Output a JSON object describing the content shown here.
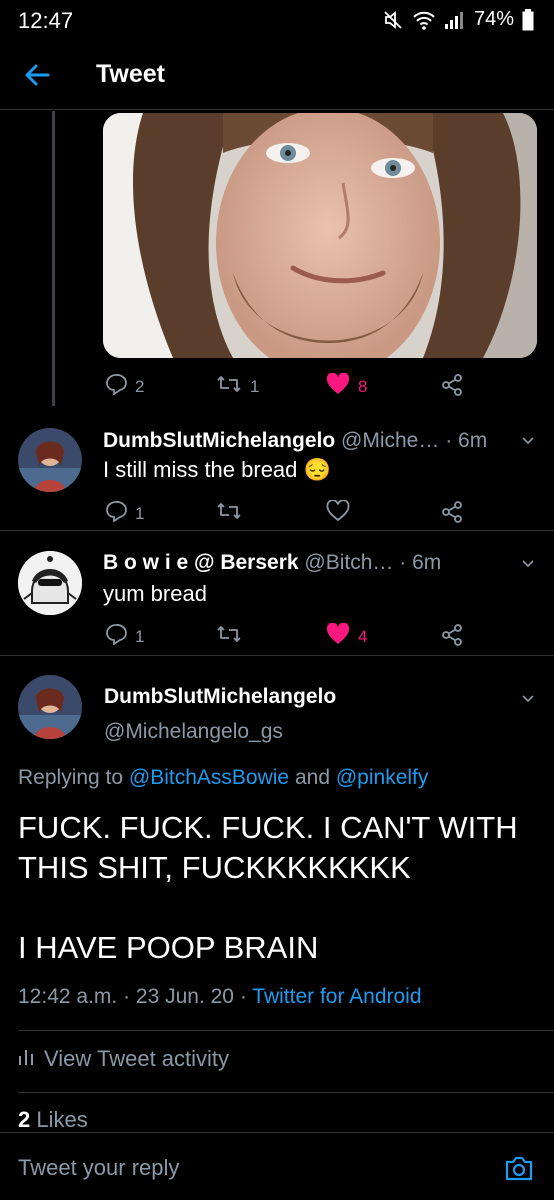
{
  "status_bar": {
    "time": "12:47",
    "battery": "74%"
  },
  "header": {
    "title": "Tweet"
  },
  "parent_tweet_actions": {
    "replies": "2",
    "retweets": "1",
    "likes": "8"
  },
  "replies": [
    {
      "name": "DumbSlutMichelangelo",
      "handle": "@Miche…",
      "time": "· 6m",
      "text": "I still miss the bread",
      "emoji": "😔",
      "replies": "1",
      "retweets": "",
      "likes": ""
    },
    {
      "name": "B o w i e @ Berserk",
      "handle": "@Bitch…",
      "time": "· 6m",
      "text": "yum bread",
      "replies": "1",
      "retweets": "",
      "likes": "4"
    }
  ],
  "main_tweet": {
    "name": "DumbSlutMichelangelo",
    "handle": "@Michelangelo_gs",
    "replying_prefix": "Replying to",
    "replying_to_1": "@BitchAssBowie",
    "replying_and": "and",
    "replying_to_2": "@pinkelfy",
    "body": "FUCK. FUCK. FUCK. I CAN'T WITH THIS SHIT, FUCKKKKKKKK\n\nI HAVE POOP BRAIN",
    "time": "12:42 a.m.",
    "date": "· 23 Jun. 20 ·",
    "source": "Twitter for Android",
    "activity_label": "View Tweet activity",
    "likes_count": "2",
    "likes_label": "Likes"
  },
  "reply_bar": {
    "placeholder": "Tweet your reply"
  },
  "colors": {
    "accent": "#1d9bf0",
    "like": "#f91880",
    "muted": "#8b98a5",
    "background": "#000000"
  }
}
